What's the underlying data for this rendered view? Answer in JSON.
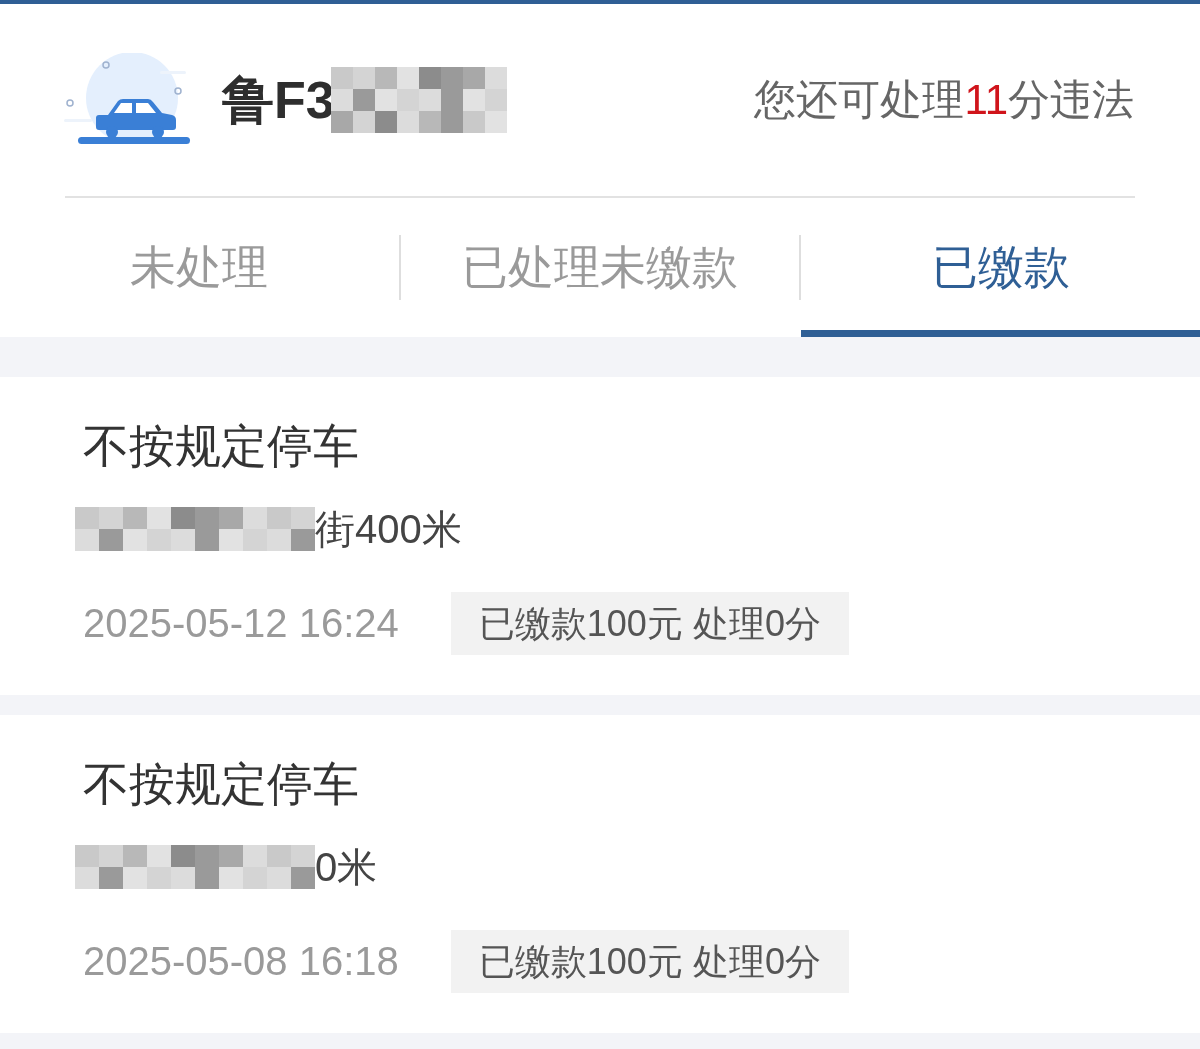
{
  "vehicle": {
    "plate": "鲁F3",
    "plate_redacted": true,
    "quota": {
      "prefix": "您还可处理",
      "count": "11",
      "suffix": "分违法"
    }
  },
  "tabs": [
    {
      "label": "未处理",
      "selected": false
    },
    {
      "label": "已处理未缴款",
      "selected": false
    },
    {
      "label": "已缴款",
      "selected": true
    }
  ],
  "violations": [
    {
      "title": "不按规定停车",
      "location": "街400米",
      "location_redacted": true,
      "time": "2025-05-12 16:24",
      "status": "已缴款100元 处理0分"
    },
    {
      "title": "不按规定停车",
      "location": "0米",
      "location_redacted": true,
      "time": "2025-05-08 16:18",
      "status": "已缴款100元 处理0分"
    }
  ]
}
